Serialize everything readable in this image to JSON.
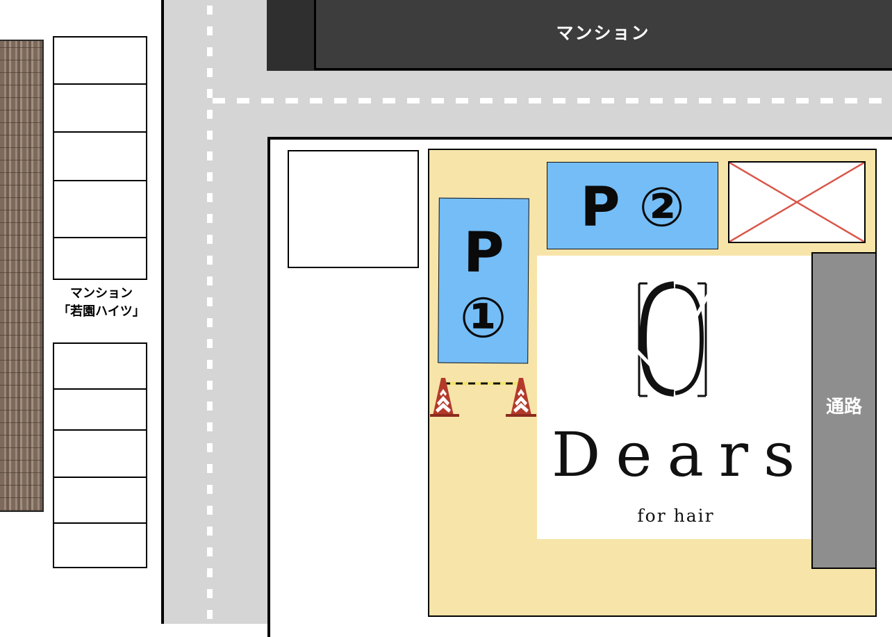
{
  "map": {
    "top_building_label": "マンション",
    "side_building_label_line1": "マンション",
    "side_building_label_line2": "「若園ハイツ」",
    "passage_label": "通路",
    "parking_spot_1": {
      "letter": "P",
      "number": "①"
    },
    "parking_spot_2": {
      "letter": "P",
      "number": "②"
    },
    "shop_name": "Dears",
    "shop_subtitle": "for hair"
  },
  "colors": {
    "parking_blue": "#74bdf7",
    "yard_yellow": "#f7e4a9",
    "road_gray": "#d5d5d5",
    "passage_gray": "#8e8e8e",
    "cone_red": "#b33a2a",
    "x_red": "#d9574a"
  },
  "icons": [
    "traffic-cone-icon",
    "no-parking-x-icon",
    "dears-logo-icon",
    "brick-wall-texture"
  ]
}
